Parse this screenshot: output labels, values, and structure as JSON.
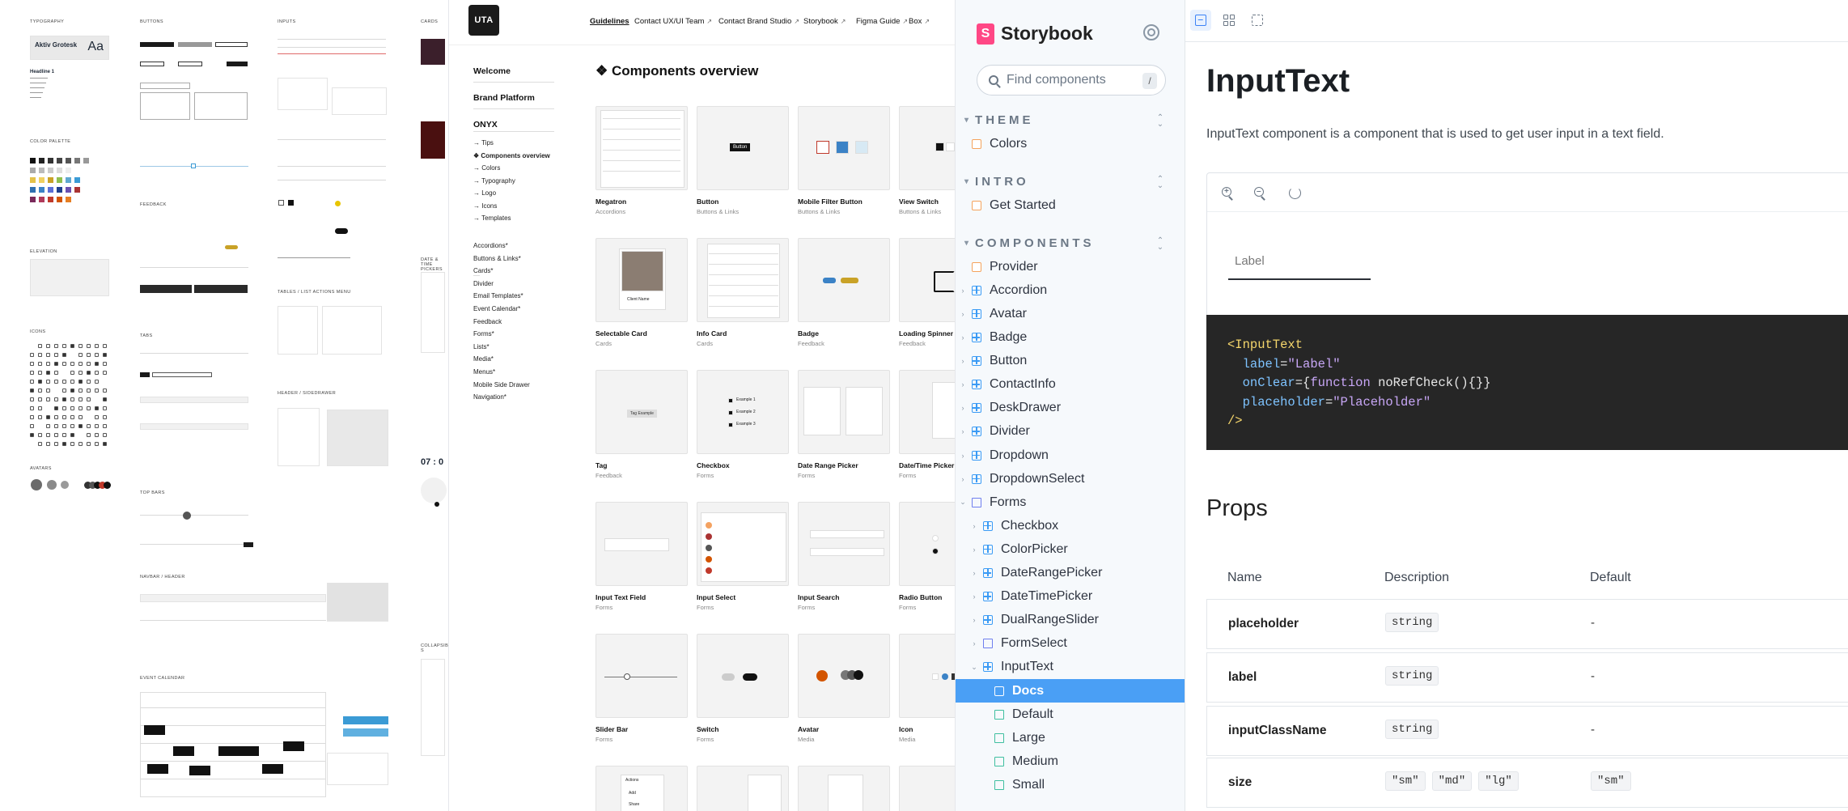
{
  "kit": {
    "sections": {
      "typography": "TYPOGRAPHY",
      "buttons": "BUTTONS",
      "inputs": "INPUTS",
      "cards": "CARDS",
      "color_palette": "COLOR PALETTE",
      "elevation": "ELEVATION",
      "icons": "ICONS",
      "avatars": "AVATARS",
      "feedback": "FEEDBACK",
      "tabs": "TABS",
      "top_bars": "TOP BARS",
      "navbar_header": "NAVBAR / HEADER",
      "event_calendar": "EVENT CALENDAR",
      "header_sidedrawer": "HEADER / SIDEDRAWER",
      "tables_actions_menu": "TABLES / LIST ACTIONS MENU",
      "date_time_pickers": "DATE & TIME PICKERS",
      "collapsible": "COLLAPSIBLE S"
    },
    "font_sample": "Aktiv Grotesk",
    "font_aa": "Aa",
    "headline": "Headline 1",
    "time_value": "07 : 0"
  },
  "uta": {
    "logo": "UTA",
    "nav": [
      {
        "label": "Guidelines",
        "external": false,
        "active": true
      },
      {
        "label": "Contact UX/UI Team",
        "external": true,
        "active": false
      },
      {
        "label": "Contact Brand Studio",
        "external": true,
        "active": false
      },
      {
        "label": "Storybook",
        "external": true,
        "active": false
      },
      {
        "label": "Figma Guide",
        "external": true,
        "active": false
      },
      {
        "label": "Box",
        "external": true,
        "active": false
      }
    ],
    "external_glyph": "↗",
    "sidebar": {
      "welcome": "Welcome",
      "brand": "Brand Platform",
      "onyx": "ONYX",
      "onyx_items": [
        "→ Tips",
        "❖ Components overview",
        "→ Colors",
        "→ Typography",
        "→ Logo",
        "→ Icons",
        "→ Templates"
      ],
      "components": [
        "Accordions*",
        "Buttons & Links*",
        "Cards*",
        "Divider",
        "Email Templates*",
        "Event Calendar*",
        "Feedback",
        "Forms*",
        "Lists*",
        "Media*",
        "Menus*",
        "Mobile Side Drawer",
        "Navigation*"
      ]
    },
    "page_title": "❖ Components overview",
    "cards": [
      {
        "name": "Megatron",
        "category": "Accordions"
      },
      {
        "name": "Button",
        "category": "Buttons & Links"
      },
      {
        "name": "Mobile Filter Button",
        "category": "Buttons & Links"
      },
      {
        "name": "View Switch",
        "category": "Buttons & Links"
      },
      {
        "name": "Selectable Card",
        "category": "Cards"
      },
      {
        "name": "Info Card",
        "category": "Cards"
      },
      {
        "name": "Badge",
        "category": "Feedback"
      },
      {
        "name": "Loading Spinner",
        "category": "Feedback"
      },
      {
        "name": "Tag",
        "category": "Feedback"
      },
      {
        "name": "Checkbox",
        "category": "Forms"
      },
      {
        "name": "Date Range Picker",
        "category": "Forms"
      },
      {
        "name": "Date/Time Picker",
        "category": "Forms"
      },
      {
        "name": "Input Text Field",
        "category": "Forms"
      },
      {
        "name": "Input Select",
        "category": "Forms"
      },
      {
        "name": "Input Search",
        "category": "Forms"
      },
      {
        "name": "Radio Button",
        "category": "Forms"
      },
      {
        "name": "Slider Bar",
        "category": "Forms"
      },
      {
        "name": "Switch",
        "category": "Forms"
      },
      {
        "name": "Avatar",
        "category": "Media"
      },
      {
        "name": "Icon",
        "category": "Media"
      },
      {
        "name": "",
        "category": ""
      },
      {
        "name": "",
        "category": ""
      },
      {
        "name": "",
        "category": ""
      },
      {
        "name": "",
        "category": ""
      }
    ],
    "thumb_text": {
      "button": "Button",
      "client": "Client Name",
      "tag": "Tag Example",
      "checks": [
        "Example 1",
        "Example 2",
        "Example 3"
      ],
      "actions": "Actions",
      "add": "Add",
      "share": "Share"
    }
  },
  "storybook": {
    "brand": "Storybook",
    "brand_mark": "S",
    "search_placeholder": "Find components",
    "search_shortcut": "/",
    "sections": [
      {
        "label": "THEME",
        "items": [
          {
            "label": "Colors",
            "kind": "doc"
          }
        ]
      },
      {
        "label": "INTRO",
        "items": [
          {
            "label": "Get Started",
            "kind": "doc"
          }
        ]
      },
      {
        "label": "COMPONENTS",
        "items": [
          {
            "label": "Provider",
            "kind": "doc",
            "depth": 0
          },
          {
            "label": "Accordion",
            "kind": "component",
            "depth": 0
          },
          {
            "label": "Avatar",
            "kind": "component",
            "depth": 0
          },
          {
            "label": "Badge",
            "kind": "component",
            "depth": 0
          },
          {
            "label": "Button",
            "kind": "component",
            "depth": 0
          },
          {
            "label": "ContactInfo",
            "kind": "component",
            "depth": 0
          },
          {
            "label": "DeskDrawer",
            "kind": "component",
            "depth": 0
          },
          {
            "label": "Divider",
            "kind": "component",
            "depth": 0
          },
          {
            "label": "Dropdown",
            "kind": "component",
            "depth": 0
          },
          {
            "label": "DropdownSelect",
            "kind": "component",
            "depth": 0
          },
          {
            "label": "Forms",
            "kind": "folder",
            "depth": 0,
            "expanded": true
          },
          {
            "label": "Checkbox",
            "kind": "component",
            "depth": 1
          },
          {
            "label": "ColorPicker",
            "kind": "component",
            "depth": 1
          },
          {
            "label": "DateRangePicker",
            "kind": "component",
            "depth": 1
          },
          {
            "label": "DateTimePicker",
            "kind": "component",
            "depth": 1
          },
          {
            "label": "DualRangeSlider",
            "kind": "component",
            "depth": 1
          },
          {
            "label": "FormSelect",
            "kind": "folder",
            "depth": 1
          },
          {
            "label": "InputText",
            "kind": "component",
            "depth": 1,
            "expanded": true
          },
          {
            "label": "Docs",
            "kind": "doc",
            "depth": 2,
            "selected": true
          },
          {
            "label": "Default",
            "kind": "story",
            "depth": 2
          },
          {
            "label": "Large",
            "kind": "story",
            "depth": 2
          },
          {
            "label": "Medium",
            "kind": "story",
            "depth": 2
          },
          {
            "label": "Small",
            "kind": "story",
            "depth": 2
          }
        ]
      }
    ]
  },
  "docs": {
    "title": "InputText",
    "description": "InputText component is a component that is used to get user input in a text field.",
    "preview_input_placeholder": "Label",
    "code": {
      "tag_open": "<InputText",
      "label_attr": "label",
      "label_value": "\"Label\"",
      "onclear_attr": "onClear",
      "onclear_kw": "function",
      "onclear_rest": " noRefCheck(){}}",
      "placeholder_attr": "placeholder",
      "placeholder_value": "\"Placeholder\"",
      "tag_close": "/>"
    },
    "props_heading": "Props",
    "props_columns": [
      "Name",
      "Description",
      "Default"
    ],
    "props_rows": [
      {
        "name": "placeholder",
        "description": [
          "string"
        ],
        "default": "-"
      },
      {
        "name": "label",
        "description": [
          "string"
        ],
        "default": "-"
      },
      {
        "name": "inputClassName",
        "description": [
          "string"
        ],
        "default": "-"
      },
      {
        "name": "size",
        "description": [
          "\"sm\"",
          "\"md\"",
          "\"lg\""
        ],
        "default": "\"sm\""
      }
    ]
  }
}
